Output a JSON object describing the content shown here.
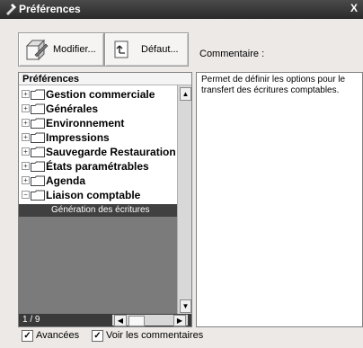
{
  "window": {
    "title": "Préférences",
    "close_symbol": "X"
  },
  "toolbar": {
    "modifier_label": "Modifier...",
    "defaut_label": "Défaut..."
  },
  "comment": {
    "label": "Commentaire :",
    "text": "Permet de définir les options pour le transfert des écritures comptables."
  },
  "preferences": {
    "header": "Préférences",
    "items": [
      {
        "label": "Gestion commerciale",
        "state": "collapsed"
      },
      {
        "label": "Générales",
        "state": "collapsed"
      },
      {
        "label": "Environnement",
        "state": "collapsed"
      },
      {
        "label": "Impressions",
        "state": "collapsed"
      },
      {
        "label": "Sauvegarde Restauration",
        "state": "collapsed"
      },
      {
        "label": "États paramétrables",
        "state": "collapsed"
      },
      {
        "label": "Agenda",
        "state": "collapsed"
      },
      {
        "label": "Liaison comptable",
        "state": "expanded"
      }
    ],
    "selected_child": "Génération des écritures",
    "pager": "1 / 9"
  },
  "options": {
    "avancees_label": "Avancées",
    "avancees_checked": true,
    "voir_commentaires_label": "Voir les commentaires",
    "voir_commentaires_checked": true
  },
  "icons": {
    "app": "preferences-app-icon",
    "modifier": "edit-icon",
    "defaut": "reset-icon",
    "folder": "folder-icon"
  }
}
